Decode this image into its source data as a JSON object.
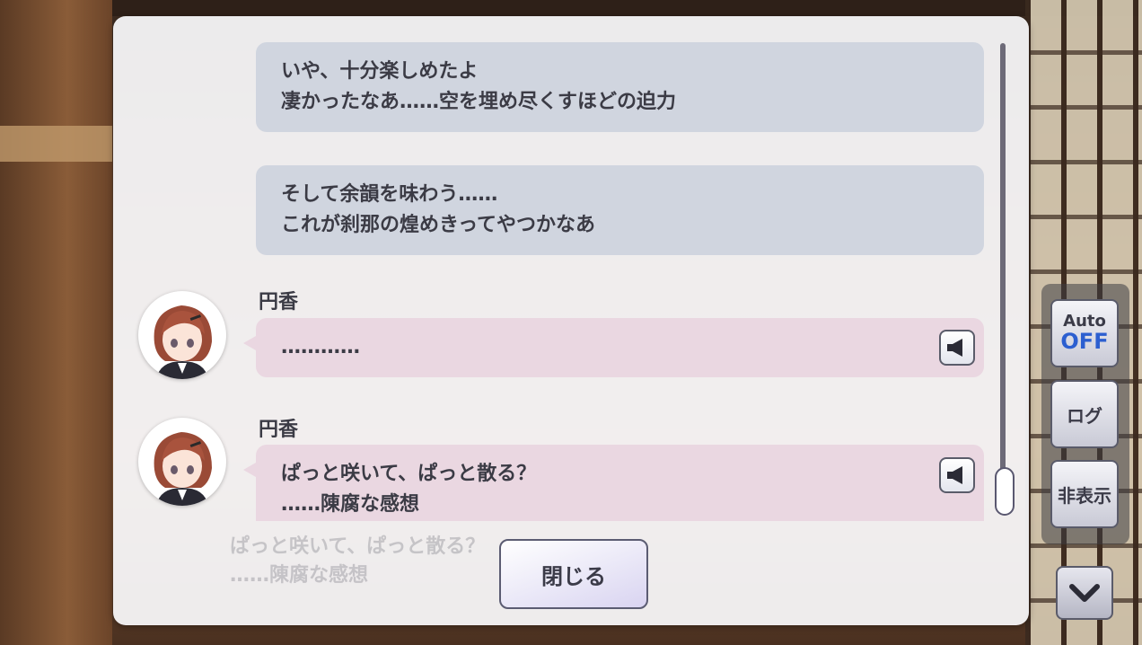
{
  "log": {
    "entries": [
      {
        "type": "narration",
        "lines": [
          "いや、十分楽しめたよ",
          "凄かったなあ……空を埋め尽くすほどの迫力"
        ]
      },
      {
        "type": "narration",
        "lines": [
          "そして余韻を味わう……",
          "これが刹那の煌めきってやつかなあ"
        ]
      },
      {
        "type": "speech",
        "speaker": "円香",
        "lines": [
          "…………"
        ],
        "has_voice": true
      },
      {
        "type": "speech",
        "speaker": "円香",
        "lines": [
          "ぱっと咲いて、ぱっと散る？",
          "……陳腐な感想"
        ],
        "has_voice": true
      }
    ],
    "close_label": "閉じる"
  },
  "background_text": {
    "line1": "ぱっと咲いて、ぱっと散る？",
    "line2": "……陳腐な感想"
  },
  "side_panel": {
    "auto_label": "Auto",
    "auto_state": "OFF",
    "log_label": "ログ",
    "hide_label": "非表示"
  },
  "icons": {
    "voice": "speaker-icon",
    "down": "chevron-down-icon"
  },
  "colors": {
    "narration_bubble": "#d0d5df",
    "speech_bubble": "#ead7e1",
    "auto_off": "#2c5fd0"
  }
}
